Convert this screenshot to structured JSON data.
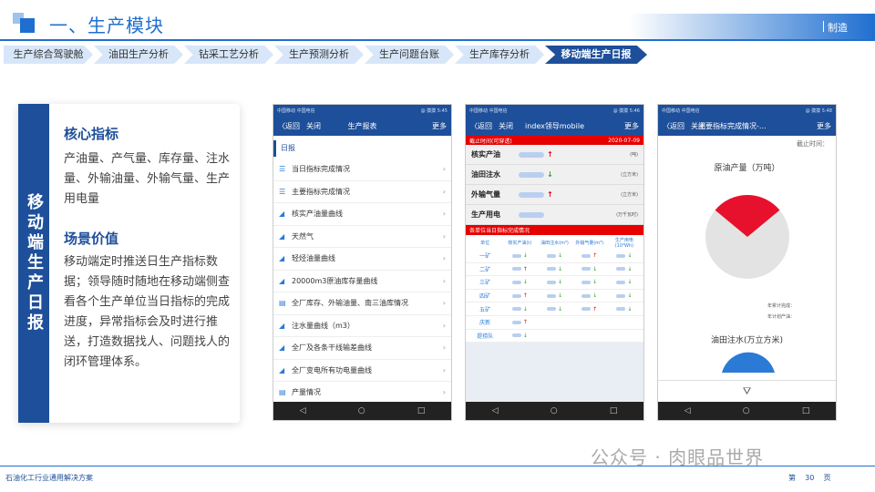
{
  "header": {
    "title": "一、生产模块",
    "right_label": "制造"
  },
  "nav": {
    "items": [
      {
        "label": "生产综合驾驶舱"
      },
      {
        "label": "油田生产分析"
      },
      {
        "label": "钻采工艺分析"
      },
      {
        "label": "生产预测分析"
      },
      {
        "label": "生产问题台账"
      },
      {
        "label": "生产库存分析"
      },
      {
        "label": "移动端生产日报"
      }
    ]
  },
  "sidebar": {
    "vertical_title": "移动端生产日报"
  },
  "content": {
    "core_title": "核心指标",
    "core_text": "产油量、产气量、库存量、注水量、外输油量、外输气量、生产用电量",
    "scene_title": "场景价值",
    "scene_text": "移动端定时推送日生产指标数据；领导随时随地在移动端侧查看各个生产单位当日指标的完成进度，异常指标会及时进行推送，打造数据找人、问题找人的闭环管理体系。"
  },
  "phone1": {
    "status_left": "中国移动 中国电信",
    "status_right": "@ 摸摸 5:45",
    "back": "〈返回",
    "close": "关闭",
    "title": "生产报表",
    "more": "更多",
    "section": "日报",
    "items": [
      {
        "label": "当日指标完成情况",
        "icon": "list-icon"
      },
      {
        "label": "主要指标完成情况",
        "icon": "list-icon"
      },
      {
        "label": "核实产油量曲线",
        "icon": "chart-icon"
      },
      {
        "label": "天然气",
        "icon": "chart-icon"
      },
      {
        "label": "轻烃油量曲线",
        "icon": "chart-icon"
      },
      {
        "label": "20000m3原油库存量曲线",
        "icon": "chart-icon"
      },
      {
        "label": "全厂库存、外输油量、南三油库情况",
        "icon": "doc-icon"
      },
      {
        "label": "注水量曲线（m3）",
        "icon": "chart-icon"
      },
      {
        "label": "全厂及各条干线输差曲线",
        "icon": "chart-icon"
      },
      {
        "label": "全厂变电所有功电量曲线",
        "icon": "chart-icon"
      },
      {
        "label": "产量情况",
        "icon": "doc-icon"
      }
    ]
  },
  "phone2": {
    "status_left": "中国移动 中国电信",
    "status_right": "@ 摸摸 5:46",
    "back": "〈返回",
    "close": "关闭",
    "title": "index领导mobile",
    "more": "更多",
    "banner_left": "截止时间(可穿透)",
    "banner_right": "2020-07-09",
    "indicators": [
      {
        "label": "核实产油",
        "unit": "(吨)",
        "dir": "up"
      },
      {
        "label": "油田注水",
        "unit": "(立方米)",
        "dir": "dn"
      },
      {
        "label": "外输气量",
        "unit": "(立方米)",
        "dir": "up"
      },
      {
        "label": "生产用电",
        "unit": "(万千瓦时)",
        "dir": ""
      }
    ],
    "table_title": "各单位当日指标完成情况",
    "table_headers": [
      "单位",
      "核实产油(t)",
      "油田注水(m³)",
      "外输气量(m³)",
      "生产用电(10⁴Wh)"
    ],
    "table_rows": [
      {
        "name": "一矿",
        "dirs": [
          "dn",
          "dn",
          "up",
          "dn"
        ]
      },
      {
        "name": "二矿",
        "dirs": [
          "up",
          "dn",
          "dn",
          "dn"
        ]
      },
      {
        "name": "三矿",
        "dirs": [
          "dn",
          "dn",
          "dn",
          "dn"
        ]
      },
      {
        "name": "四矿",
        "dirs": [
          "up",
          "dn",
          "dn",
          "dn"
        ]
      },
      {
        "name": "五矿",
        "dirs": [
          "dn",
          "dn",
          "up",
          "dn"
        ]
      },
      {
        "name": "庆新",
        "dirs": [
          "up",
          "",
          "",
          ""
        ]
      },
      {
        "name": "提捞队",
        "dirs": [
          "dn",
          "",
          "",
          ""
        ]
      }
    ]
  },
  "phone3": {
    "status_left": "中国移动 中国电信",
    "status_right": "@ 摸摸 5:48",
    "back": "〈返回",
    "close": "关闭",
    "title": "主要指标完成情况-...",
    "more": "更多",
    "date_label": "截止时间：",
    "chart1_title": "原油产量（万吨）",
    "chart1_labels": [
      "年累计完成：",
      "年计划产油："
    ],
    "chart2_title": "油田注水(万立方米)",
    "filter_icon": "filter-icon"
  },
  "chart_data": {
    "type": "pie",
    "title": "原油产量（万吨）",
    "values": [
      0.28,
      0.72
    ]
  },
  "watermark": "公众号 · 肉眼品世界",
  "footer": {
    "left": "石油化工行业通用解决方案",
    "page_label": "第",
    "page_num": "30",
    "page_unit": "页"
  },
  "colors": {
    "primary": "#1e4f9a",
    "accent": "#1f6fd0",
    "red": "#e60000",
    "green": "#2a9b2a"
  }
}
